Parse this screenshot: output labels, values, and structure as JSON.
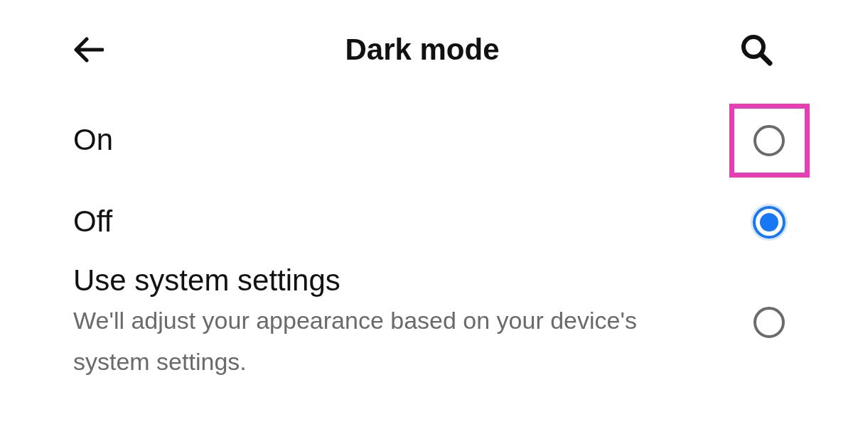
{
  "header": {
    "title": "Dark mode"
  },
  "options": [
    {
      "label": "On",
      "selected": false,
      "highlighted": true
    },
    {
      "label": "Off",
      "selected": true,
      "highlighted": false
    },
    {
      "label": "Use system settings",
      "description": "We'll adjust your appearance based on your device's system settings.",
      "selected": false,
      "highlighted": false
    }
  ]
}
